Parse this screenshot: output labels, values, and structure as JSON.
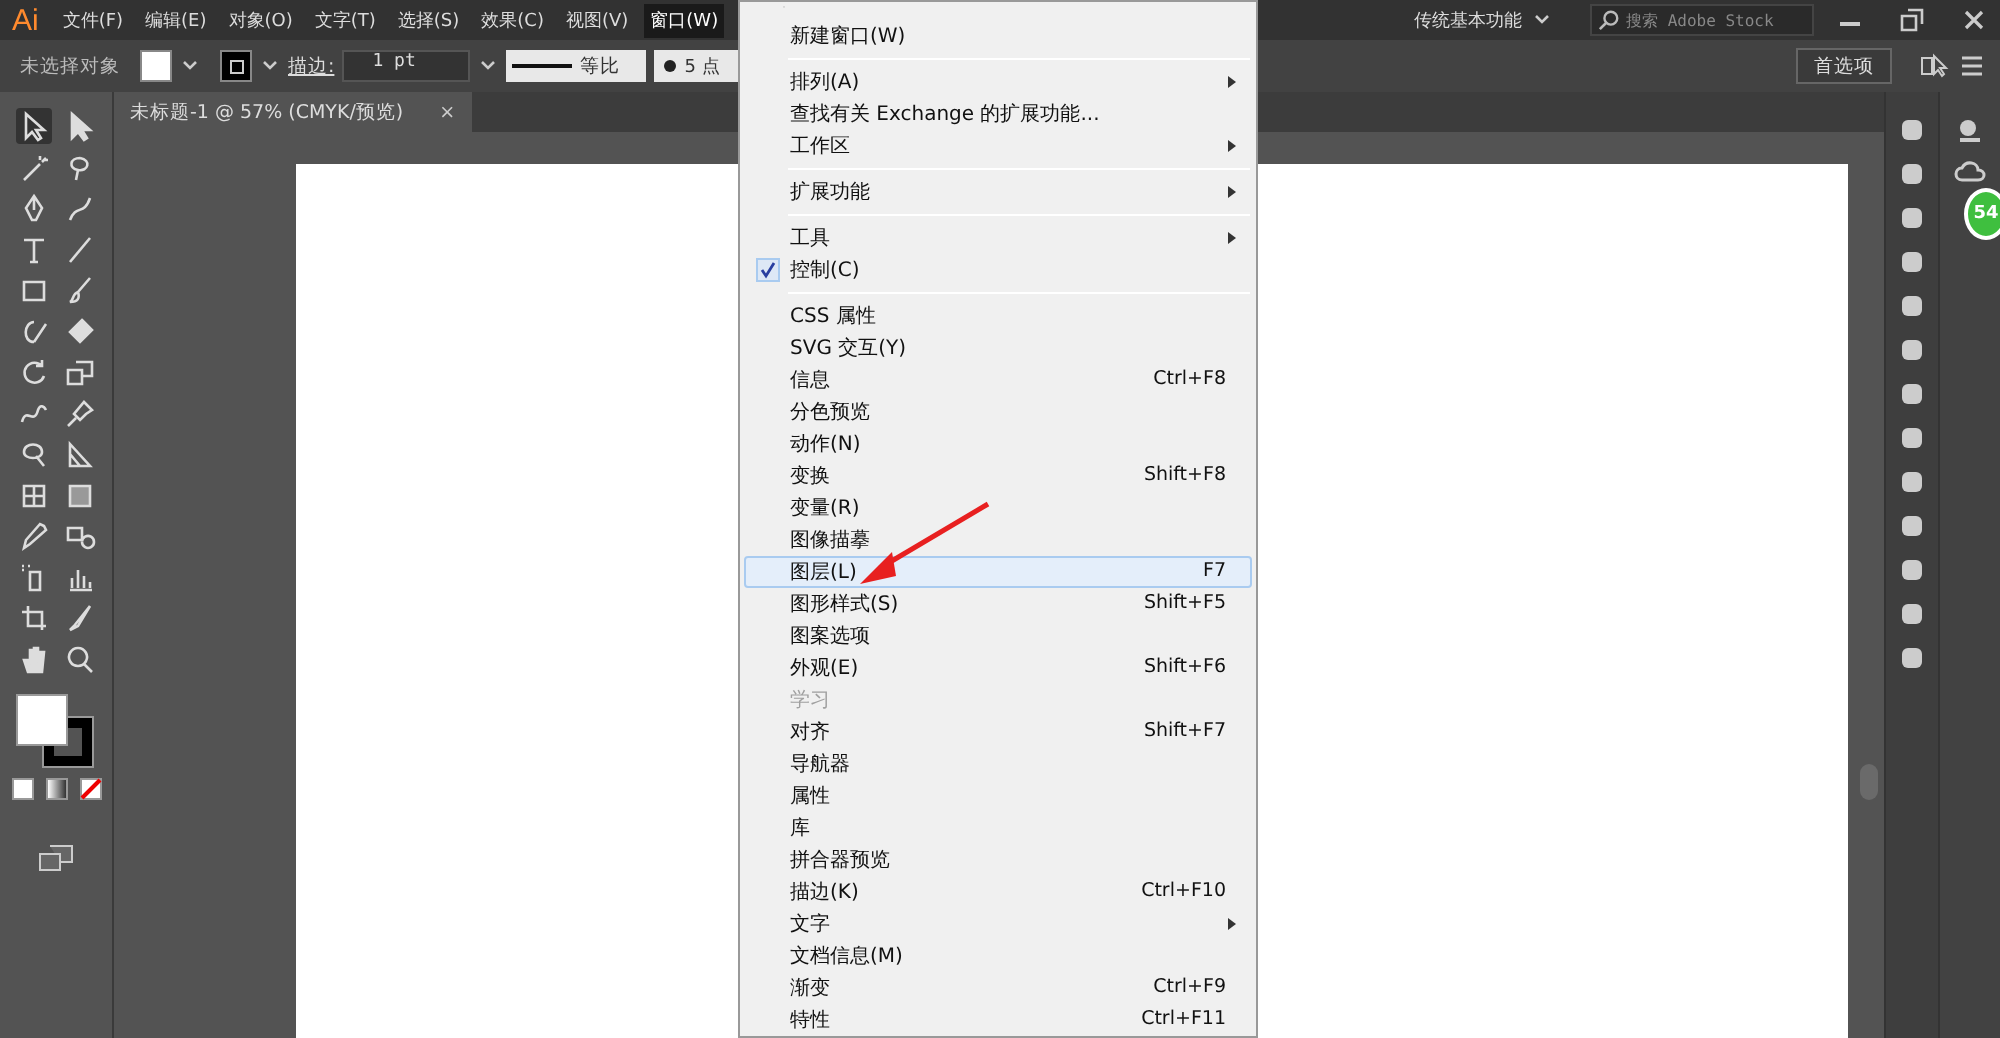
{
  "app": {
    "logo": "Ai"
  },
  "menubar": [
    {
      "label": "文件(F)",
      "selected": false
    },
    {
      "label": "编辑(E)",
      "selected": false
    },
    {
      "label": "对象(O)",
      "selected": false
    },
    {
      "label": "文字(T)",
      "selected": false
    },
    {
      "label": "选择(S)",
      "selected": false
    },
    {
      "label": "效果(C)",
      "selected": false
    },
    {
      "label": "视图(V)",
      "selected": false
    },
    {
      "label": "窗口(W)",
      "selected": true
    }
  ],
  "workspace": {
    "label": "传统基本功能"
  },
  "search": {
    "placeholder": "搜索 Adobe Stock"
  },
  "control_bar": {
    "selection": "未选择对象",
    "stroke_label": "描边:",
    "stroke_weight": "1 pt",
    "profile": "等比",
    "brush": "5 点",
    "preferences": "首选项"
  },
  "document_tab": {
    "title": "未标题-1 @ 57% (CMYK/预览)",
    "close": "×"
  },
  "badge": {
    "text": "54"
  },
  "window_menu": [
    {
      "kind": "item",
      "label": "新建窗口(W)",
      "submenu": false,
      "checked": false,
      "disabled": false,
      "selected": false
    },
    {
      "kind": "separator"
    },
    {
      "kind": "item",
      "label": "排列(A)",
      "submenu": true,
      "checked": false,
      "disabled": false,
      "selected": false
    },
    {
      "kind": "item",
      "label": "查找有关 Exchange 的扩展功能...",
      "submenu": false,
      "checked": false,
      "disabled": false,
      "selected": false
    },
    {
      "kind": "item",
      "label": "工作区",
      "submenu": true,
      "checked": false,
      "disabled": false,
      "selected": false
    },
    {
      "kind": "separator"
    },
    {
      "kind": "item",
      "label": "扩展功能",
      "submenu": true,
      "checked": false,
      "disabled": false,
      "selected": false
    },
    {
      "kind": "separator"
    },
    {
      "kind": "item",
      "label": "工具",
      "submenu": true,
      "checked": false,
      "disabled": false,
      "selected": false
    },
    {
      "kind": "item",
      "label": "控制(C)",
      "submenu": false,
      "checked": true,
      "disabled": false,
      "selected": false
    },
    {
      "kind": "separator"
    },
    {
      "kind": "item",
      "label": "CSS 属性",
      "submenu": false,
      "checked": false,
      "disabled": false,
      "selected": false
    },
    {
      "kind": "item",
      "label": "SVG 交互(Y)",
      "submenu": false,
      "checked": false,
      "disabled": false,
      "selected": false
    },
    {
      "kind": "item",
      "label": "信息",
      "shortcut": "Ctrl+F8",
      "submenu": false,
      "checked": false,
      "disabled": false,
      "selected": false
    },
    {
      "kind": "item",
      "label": "分色预览",
      "submenu": false,
      "checked": false,
      "disabled": false,
      "selected": false
    },
    {
      "kind": "item",
      "label": "动作(N)",
      "submenu": false,
      "checked": false,
      "disabled": false,
      "selected": false
    },
    {
      "kind": "item",
      "label": "变换",
      "shortcut": "Shift+F8",
      "submenu": false,
      "checked": false,
      "disabled": false,
      "selected": false
    },
    {
      "kind": "item",
      "label": "变量(R)",
      "submenu": false,
      "checked": false,
      "disabled": false,
      "selected": false
    },
    {
      "kind": "item",
      "label": "图像描摹",
      "submenu": false,
      "checked": false,
      "disabled": false,
      "selected": false
    },
    {
      "kind": "item",
      "label": "图层(L)",
      "shortcut": "F7",
      "submenu": false,
      "checked": false,
      "disabled": false,
      "selected": true
    },
    {
      "kind": "item",
      "label": "图形样式(S)",
      "shortcut": "Shift+F5",
      "submenu": false,
      "checked": false,
      "disabled": false,
      "selected": false
    },
    {
      "kind": "item",
      "label": "图案选项",
      "submenu": false,
      "checked": false,
      "disabled": false,
      "selected": false
    },
    {
      "kind": "item",
      "label": "外观(E)",
      "shortcut": "Shift+F6",
      "submenu": false,
      "checked": false,
      "disabled": false,
      "selected": false
    },
    {
      "kind": "item",
      "label": "学习",
      "submenu": false,
      "checked": false,
      "disabled": true,
      "selected": false
    },
    {
      "kind": "item",
      "label": "对齐",
      "shortcut": "Shift+F7",
      "submenu": false,
      "checked": false,
      "disabled": false,
      "selected": false
    },
    {
      "kind": "item",
      "label": "导航器",
      "submenu": false,
      "checked": false,
      "disabled": false,
      "selected": false
    },
    {
      "kind": "item",
      "label": "属性",
      "submenu": false,
      "checked": false,
      "disabled": false,
      "selected": false
    },
    {
      "kind": "item",
      "label": "库",
      "submenu": false,
      "checked": false,
      "disabled": false,
      "selected": false
    },
    {
      "kind": "item",
      "label": "拼合器预览",
      "submenu": false,
      "checked": false,
      "disabled": false,
      "selected": false
    },
    {
      "kind": "item",
      "label": "描边(K)",
      "shortcut": "Ctrl+F10",
      "submenu": false,
      "checked": false,
      "disabled": false,
      "selected": false
    },
    {
      "kind": "item",
      "label": "文字",
      "submenu": true,
      "checked": false,
      "disabled": false,
      "selected": false
    },
    {
      "kind": "item",
      "label": "文档信息(M)",
      "submenu": false,
      "checked": false,
      "disabled": false,
      "selected": false
    },
    {
      "kind": "item",
      "label": "渐变",
      "shortcut": "Ctrl+F9",
      "submenu": false,
      "checked": false,
      "disabled": false,
      "selected": false
    },
    {
      "kind": "item",
      "label": "特性",
      "shortcut": "Ctrl+F11",
      "submenu": false,
      "checked": false,
      "disabled": false,
      "selected": false
    }
  ]
}
